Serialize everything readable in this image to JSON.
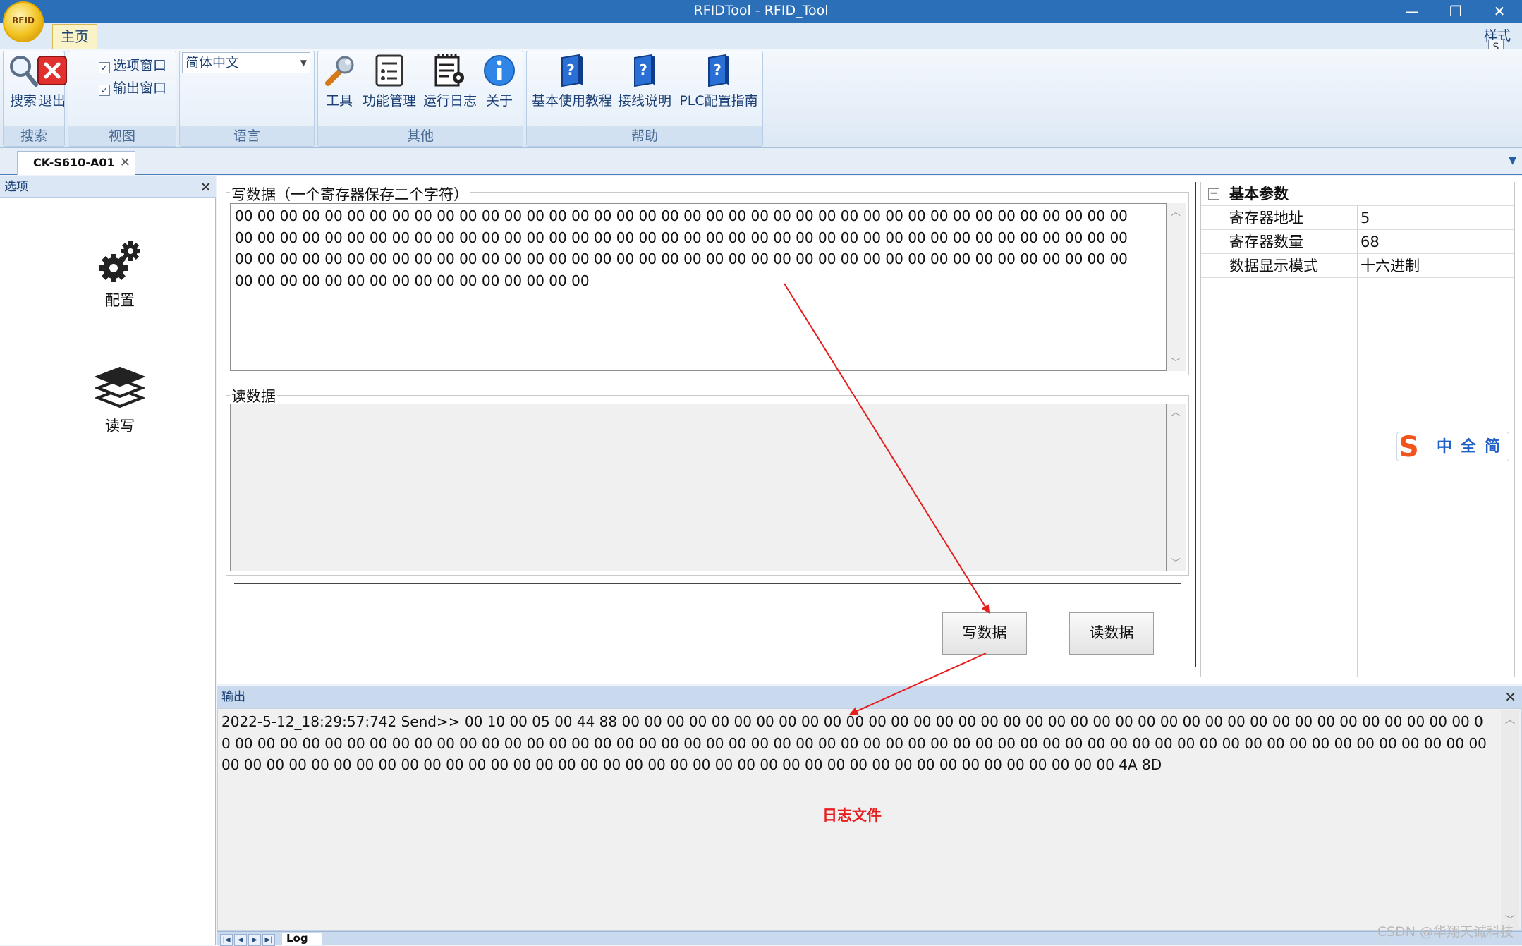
{
  "window": {
    "title": "RFIDTool - RFID_Tool",
    "minimize": "—",
    "restore": "❐",
    "close": "✕",
    "logo_text": "RFID"
  },
  "ribbon": {
    "tab_home": "主页",
    "style_menu": "样式",
    "style_key": "S",
    "groups": {
      "search": "搜索",
      "view": "视图",
      "language": "语言",
      "other": "其他",
      "help": "帮助"
    },
    "buttons": {
      "search": "搜索",
      "exit": "退出",
      "tools": "工具",
      "func_manage": "功能管理",
      "run_log": "运行日志",
      "about": "关于",
      "basic_tutorial": "基本使用教程",
      "wiring": "接线说明",
      "plc_guide": "PLC配置指南"
    },
    "checkboxes": {
      "options_window": "选项窗口",
      "output_window": "输出窗口"
    },
    "language_select": "简体中文"
  },
  "doc_tab": "CK-S610-A01",
  "left_panel": {
    "title": "选项",
    "items": {
      "config": "配置",
      "read_write": "读写"
    }
  },
  "main": {
    "write_legend": "写数据（一个寄存器保存二个字符）",
    "write_text": "00 00 00 00 00 00 00 00 00 00 00 00 00 00 00 00 00 00 00 00 00 00 00 00 00 00 00 00 00 00 00 00 00 00 00 00 00 00 00 00 00 00 00 00 00 00 00 00 00 00 00 00 00 00 00 00 00 00 00 00 00 00 00 00 00 00 00 00 00 00 00 00 00 00 00 00 00 00 00 00 00 00 00 00 00 00 00 00 00 00 00 00 00 00 00 00 00 00 00 00 00 00 00 00 00 00 00 00 00 00 00 00 00 00 00 00 00 00 00 00 00 00 00 00 00 00 00 00 00 00 00 00 00 00 00 00",
    "read_legend": "读数据",
    "write_button": "写数据",
    "read_button": "读数据"
  },
  "properties": {
    "group": "基本参数",
    "rows": [
      {
        "key": "寄存器地址",
        "value": "5"
      },
      {
        "key": "寄存器数量",
        "value": "68"
      },
      {
        "key": "数据显示模式",
        "value": "十六进制"
      }
    ]
  },
  "ime": {
    "logo": "S",
    "text": "中全简"
  },
  "output": {
    "title": "输出",
    "log_line": "2022-5-12_18:29:57:742   Send>> 00 10 00 05 00 44 88 00 00 00 00 00 00 00 00 00 00 00 00 00 00 00 00 00 00 00 00 00 00 00 00 00 00 00 00 00 00 00 00 00 00 00 00 00 00 00 00 00 00 00 00 00 00 00 00 00 00 00 00 00 00 00 00 00 00 00 00 00 00 00 00 00 00 00 00 00 00 00 00 00 00 00 00 00 00 00 00 00 00 00 00 00 00 00 00 00 00 00 00 00 00 00 00 00 00 00 00 00 00 00 00 00 00 00 00 00 00 00 00 00 00 00 00 00 00 00 00 00 00 00 00 00 00 00 00 00 00 00 00 00 00 00 4A 8D",
    "annotation": "日志文件",
    "log_tab": "Log",
    "nav": [
      "|◀",
      "◀",
      "▶",
      "▶|"
    ]
  },
  "watermark": "CSDN @华翔天诚科技",
  "colors": {
    "accent": "#2a6fb8",
    "annotation": "#e61e1e"
  }
}
